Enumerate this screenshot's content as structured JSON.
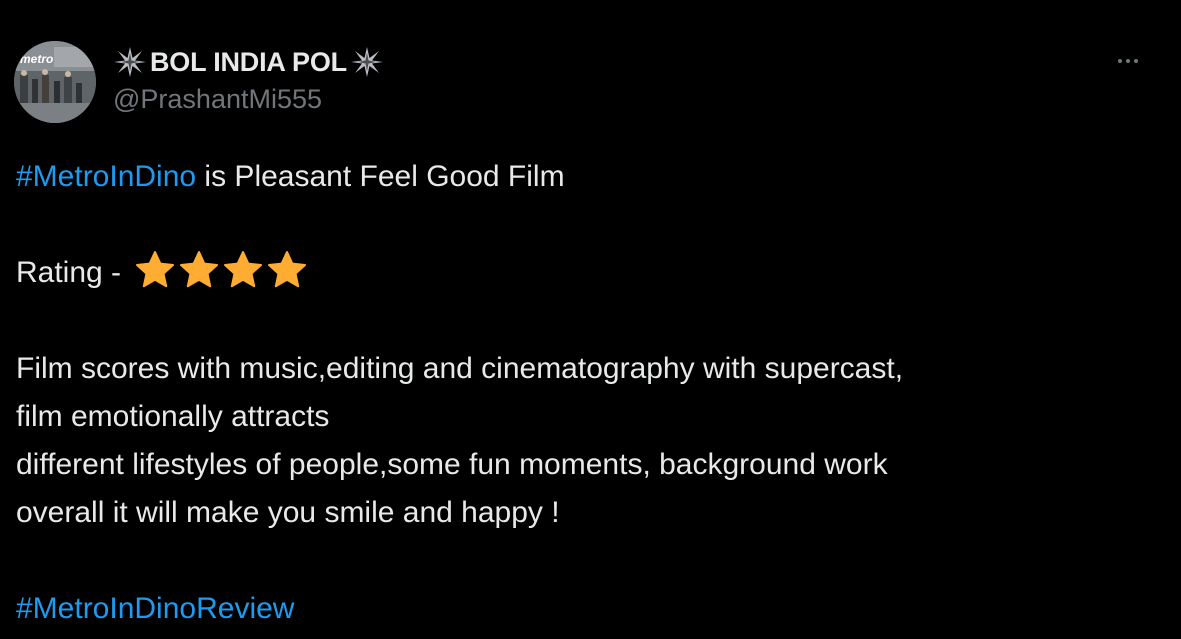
{
  "author": {
    "display_name": "BOL INDIA POL",
    "handle": "@PrashantMi555",
    "avatar_text": "metro"
  },
  "icons": {
    "name_decoration": "sparkle-icon",
    "more": "more-dots-icon",
    "rating": "star-icon"
  },
  "colors": {
    "background": "#000000",
    "text": "#e7e9ea",
    "secondary": "#71767b",
    "link": "#1d9bf0",
    "star": "#ffac33"
  },
  "tweet": {
    "line1": {
      "hashtag": "#MetroInDino",
      "text": " is Pleasant Feel Good Film"
    },
    "rating_label": "Rating - ",
    "rating_stars": 4,
    "lines": [
      "Film scores with music,editing and cinematography with supercast,",
      "film emotionally attracts",
      "different lifestyles of people,some fun moments, background work",
      "overall it will make you smile and happy !"
    ],
    "closing_hashtag": "#MetroInDinoReview"
  }
}
